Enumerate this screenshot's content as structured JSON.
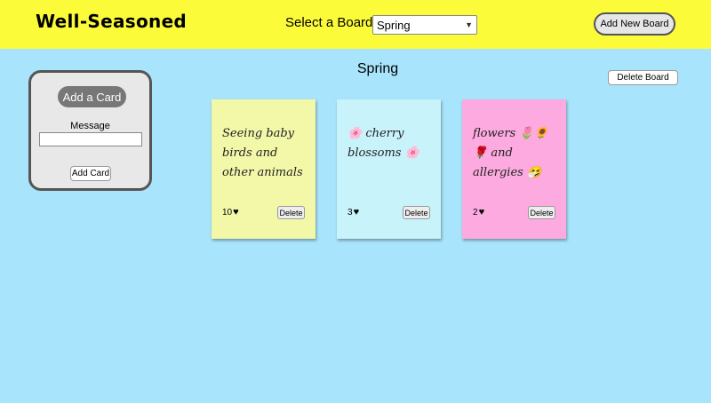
{
  "header": {
    "logo": "Well-Seasoned",
    "select_label": "Select a Board",
    "selected_board": "Spring",
    "add_board_label": "Add New Board"
  },
  "panel": {
    "title": "Add a Card",
    "message_label": "Message",
    "message_value": "",
    "submit_label": "Add Card"
  },
  "board": {
    "title": "Spring",
    "delete_label": "Delete Board"
  },
  "cards": [
    {
      "text": "Seeing baby birds and other animals",
      "likes": "10",
      "delete_label": "Delete",
      "color": "#f3f8a8"
    },
    {
      "text": "🌸 cherry blossoms 🌸",
      "likes": "3",
      "delete_label": "Delete",
      "color": "#c8f3fb"
    },
    {
      "text": "flowers 🌷🌻 🌹 and allergies 🤧",
      "likes": "2",
      "delete_label": "Delete",
      "color": "#fcaae0"
    }
  ],
  "colors": {
    "header_bg": "#fbfb3a",
    "page_bg": "#a8e4fb"
  },
  "icons": {
    "heart": "♥",
    "dropdown": "⌄"
  }
}
